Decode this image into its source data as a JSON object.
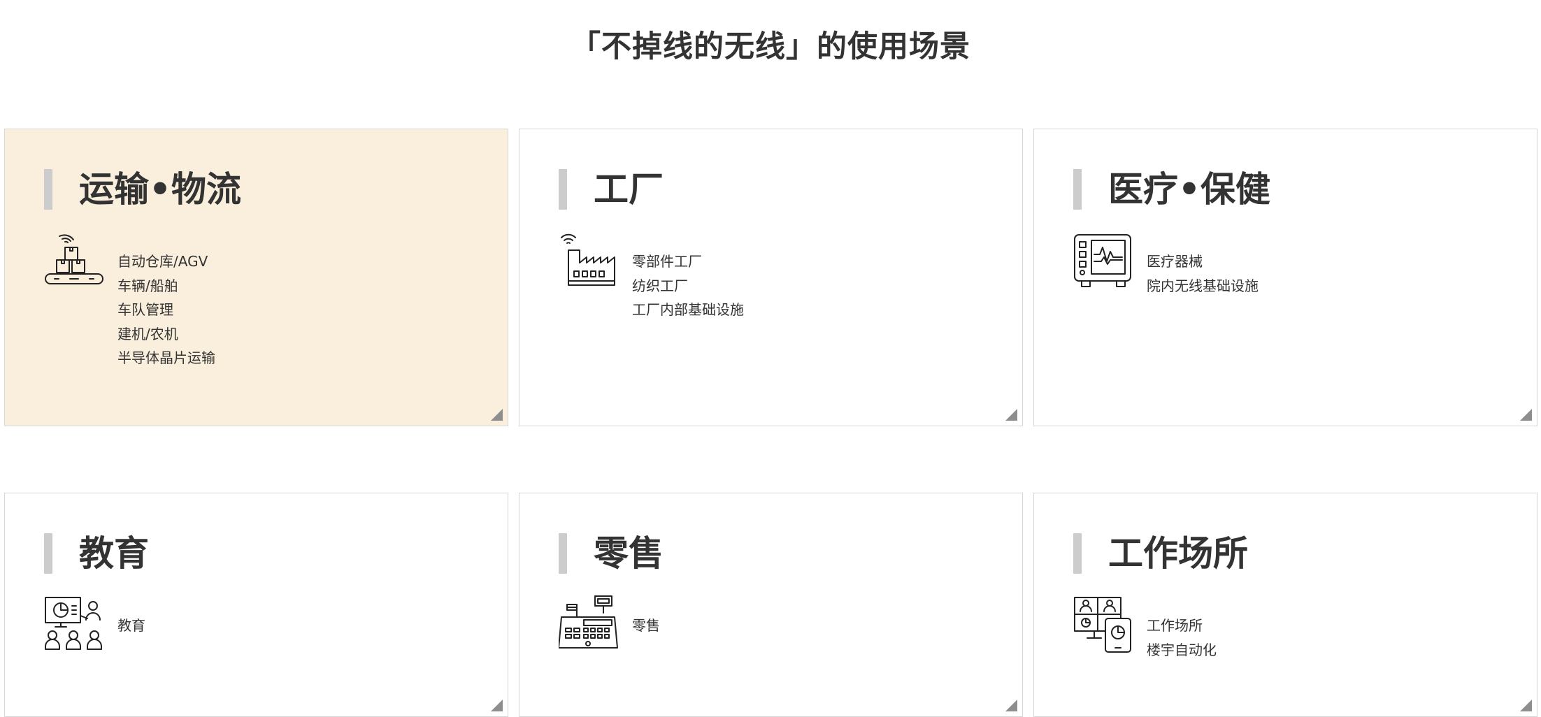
{
  "page": {
    "title": "「不掉线的无线」的使用场景"
  },
  "cards": [
    {
      "title": "运输•物流",
      "icon": "conveyor-wifi-icon",
      "items": [
        "自动仓库/AGV",
        "车辆/船舶",
        "车队管理",
        "建机/农机",
        "半导体晶片运输"
      ]
    },
    {
      "title": "工厂",
      "icon": "factory-wifi-icon",
      "items": [
        "零部件工厂",
        "纺织工厂",
        "工厂内部基础设施"
      ]
    },
    {
      "title": "医疗•保健",
      "icon": "medical-monitor-icon",
      "items": [
        "医疗器械",
        "院内无线基础设施"
      ]
    },
    {
      "title": "教育",
      "icon": "classroom-icon",
      "items": [
        "教育"
      ]
    },
    {
      "title": "零售",
      "icon": "cash-register-icon",
      "items": [
        "零售"
      ]
    },
    {
      "title": "工作场所",
      "icon": "workplace-devices-icon",
      "items": [
        "工作场所",
        "楼宇自动化"
      ]
    }
  ],
  "colors": {
    "active_card_bg": "#f9efdc",
    "accent_bar": "#cccccc",
    "text": "#333333",
    "border": "#d7d7d7",
    "corner": "#8e8e8e"
  }
}
